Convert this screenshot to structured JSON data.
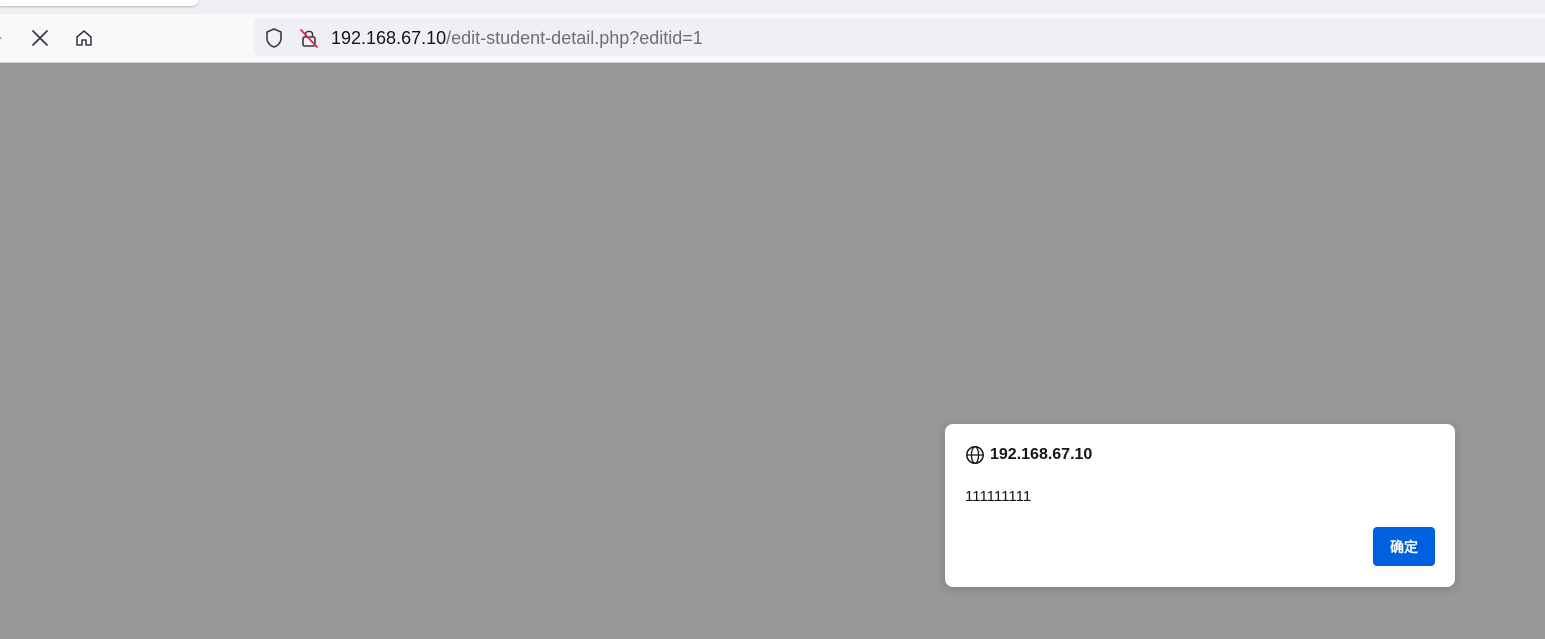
{
  "browser": {
    "url_host": "192.168.67.10",
    "url_path": "/edit-student-detail.php?editid=1",
    "colors": {
      "urlbar_bg": "#f0f0f4",
      "page_overlay": "#98989a"
    },
    "icons": [
      "forward-icon",
      "stop-icon",
      "home-icon",
      "tracking-shield-icon",
      "insecure-lock-icon"
    ]
  },
  "dialog": {
    "origin": "192.168.67.10",
    "message": "111111111",
    "ok_label": "确定",
    "icon": "globe-icon",
    "colors": {
      "ok_button": "#0061e0"
    }
  }
}
